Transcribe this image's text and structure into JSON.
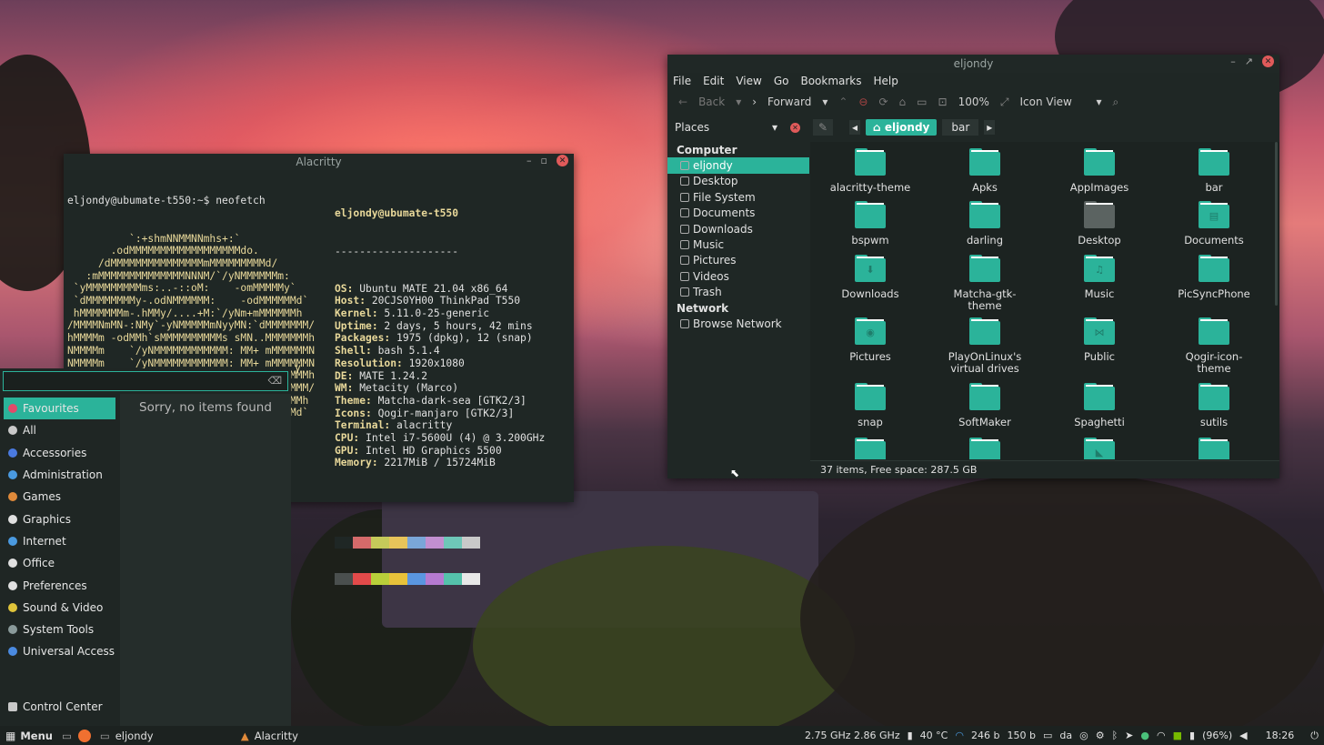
{
  "terminal": {
    "title": "Alacritty",
    "prompt": "eljondy@ubumate-t550:~$ neofetch",
    "logo_lines": [
      "          `:+shmNNMMNNmhs+:`",
      "       .odMMMMMMMMMMMMMMMMMMdo.",
      "     /dMMMMMMMMMMMMMMMmMMMMMMMMMd/",
      "   :mMMMMMMMMMMMMMMNNNM/`/yNMMMMMMm:",
      " `yMMMMMMMMMms:..-::oM:    -omMMMMMy`",
      " `dMMMMMMMMy-.odNMMMMMM:    -odMMMMMMd`",
      " hMMMMMMMm-.hMMy/....+M:`/yNm+mMMMMMMh",
      "/MMMMNmMN-:NMy`-yNMMMMMmNyyMN:`dMMMMMMM/",
      "hMMMMm -odMMh`sMMMMMMMMMMs sMN..MMMMMMMh",
      "NMMMMm    `/yNMMMMMMMMMMMM: MM+ mMMMMMMN",
      "NMMMMm    `/yNMMMMMMMMMMMM: MM+ mMMMMMMN",
      "hMMMMm -odMMh sMMMMMMMMMMs oMN..MMMMMMMh",
      "/MMMMNNMN-:NMy`-yNMMMMMNNsyMN:`dMMMMMMM/",
      " hMMMMMMMm-.hMMy/....+M:.+hNd+mMMMMMMMh",
      " `dMMMMMMMy-.odNMMMMMM:    :smMMMMMMMd`"
    ],
    "tail_char": "y",
    "user_host": "eljondy@ubumate-t550",
    "separator": "--------------------",
    "info": [
      {
        "k": "OS",
        "v": "Ubuntu MATE 21.04 x86_64"
      },
      {
        "k": "Host",
        "v": "20CJS0YH00 ThinkPad T550"
      },
      {
        "k": "Kernel",
        "v": "5.11.0-25-generic"
      },
      {
        "k": "Uptime",
        "v": "2 days, 5 hours, 42 mins"
      },
      {
        "k": "Packages",
        "v": "1975 (dpkg), 12 (snap)"
      },
      {
        "k": "Shell",
        "v": "bash 5.1.4"
      },
      {
        "k": "Resolution",
        "v": "1920x1080"
      },
      {
        "k": "DE",
        "v": "MATE 1.24.2"
      },
      {
        "k": "WM",
        "v": "Metacity (Marco)"
      },
      {
        "k": "Theme",
        "v": "Matcha-dark-sea [GTK2/3]"
      },
      {
        "k": "Icons",
        "v": "Qogir-manjaro [GTK2/3]"
      },
      {
        "k": "Terminal",
        "v": "alacritty"
      },
      {
        "k": "CPU",
        "v": "Intel i7-5600U (4) @ 3.200GHz"
      },
      {
        "k": "GPU",
        "v": "Intel HD Graphics 5500"
      },
      {
        "k": "Memory",
        "v": "2217MiB / 15724MiB"
      }
    ],
    "palette_top": [
      "#1f2725",
      "#d46a6a",
      "#c5c95a",
      "#e8c45a",
      "#7aa6d8",
      "#c28fd0",
      "#6ec7b8",
      "#c9c9c9"
    ],
    "palette_bottom": [
      "#4a4f4e",
      "#e24a4a",
      "#b9cf3a",
      "#e8c23a",
      "#5a96e0",
      "#b57ad0",
      "#55c2ab",
      "#e8e8e8"
    ]
  },
  "filemanager": {
    "title": "eljondy",
    "menu": [
      "File",
      "Edit",
      "View",
      "Go",
      "Bookmarks",
      "Help"
    ],
    "back": "Back",
    "forward": "Forward",
    "zoom": "100%",
    "view_mode": "Icon View",
    "places_label": "Places",
    "crumbs": [
      "eljondy",
      "bar"
    ],
    "sections": [
      {
        "head": "Computer",
        "items": [
          "eljondy",
          "Desktop",
          "File System",
          "Documents",
          "Downloads",
          "Music",
          "Pictures",
          "Videos",
          "Trash"
        ]
      },
      {
        "head": "Network",
        "items": [
          "Browse Network"
        ]
      }
    ],
    "selected_item": "eljondy",
    "files": [
      {
        "name": "alacritty-theme",
        "glyph": ""
      },
      {
        "name": "Apks",
        "glyph": ""
      },
      {
        "name": "AppImages",
        "glyph": ""
      },
      {
        "name": "bar",
        "glyph": ""
      },
      {
        "name": "bspwm",
        "glyph": ""
      },
      {
        "name": "darling",
        "glyph": ""
      },
      {
        "name": "Desktop",
        "glyph": "",
        "gray": true
      },
      {
        "name": "Documents",
        "glyph": "▤"
      },
      {
        "name": "Downloads",
        "glyph": "⬇"
      },
      {
        "name": "Matcha-gtk-theme",
        "glyph": ""
      },
      {
        "name": "Music",
        "glyph": "♫"
      },
      {
        "name": "PicSyncPhone",
        "glyph": ""
      },
      {
        "name": "Pictures",
        "glyph": "◉"
      },
      {
        "name": "PlayOnLinux's virtual drives",
        "glyph": ""
      },
      {
        "name": "Public",
        "glyph": "⋈"
      },
      {
        "name": "Qogir-icon-theme",
        "glyph": ""
      },
      {
        "name": "snap",
        "glyph": ""
      },
      {
        "name": "SoftMaker",
        "glyph": ""
      },
      {
        "name": "Spaghetti",
        "glyph": ""
      },
      {
        "name": "sutils",
        "glyph": ""
      },
      {
        "name": "",
        "glyph": ""
      },
      {
        "name": "",
        "glyph": ""
      },
      {
        "name": "",
        "glyph": "◣"
      },
      {
        "name": "",
        "glyph": ""
      }
    ],
    "status": "37 items, Free space: 287.5 GB"
  },
  "appmenu": {
    "search_placeholder": "",
    "categories": [
      {
        "label": "Favourites",
        "color": "#e24a6a"
      },
      {
        "label": "All",
        "color": "#c9c9c9"
      },
      {
        "label": "Accessories",
        "color": "#4a7ae0"
      },
      {
        "label": "Administration",
        "color": "#4a9ae0"
      },
      {
        "label": "Games",
        "color": "#e08a3a"
      },
      {
        "label": "Graphics",
        "color": "#e0e0e0"
      },
      {
        "label": "Internet",
        "color": "#4a9ae0"
      },
      {
        "label": "Office",
        "color": "#e0e0e0"
      },
      {
        "label": "Preferences",
        "color": "#e0e0e0"
      },
      {
        "label": "Sound & Video",
        "color": "#e0c43a"
      },
      {
        "label": "System Tools",
        "color": "#8a9a9a"
      },
      {
        "label": "Universal Access",
        "color": "#4a8ae0"
      }
    ],
    "control_center": "Control Center",
    "empty_text": "Sorry, no items found"
  },
  "taskbar": {
    "menu_label": "Menu",
    "tasks": [
      "eljondy",
      "Alacritty"
    ],
    "cpu_freq": "2.75 GHz 2.86 GHz",
    "temp": "40 °C",
    "net_down": "246 b",
    "net_up": "150 b",
    "kbd": "da",
    "battery": "(96%)",
    "clock": "18:26"
  },
  "colors": {
    "accent": "#2bb39a",
    "panel": "#1f2725"
  }
}
